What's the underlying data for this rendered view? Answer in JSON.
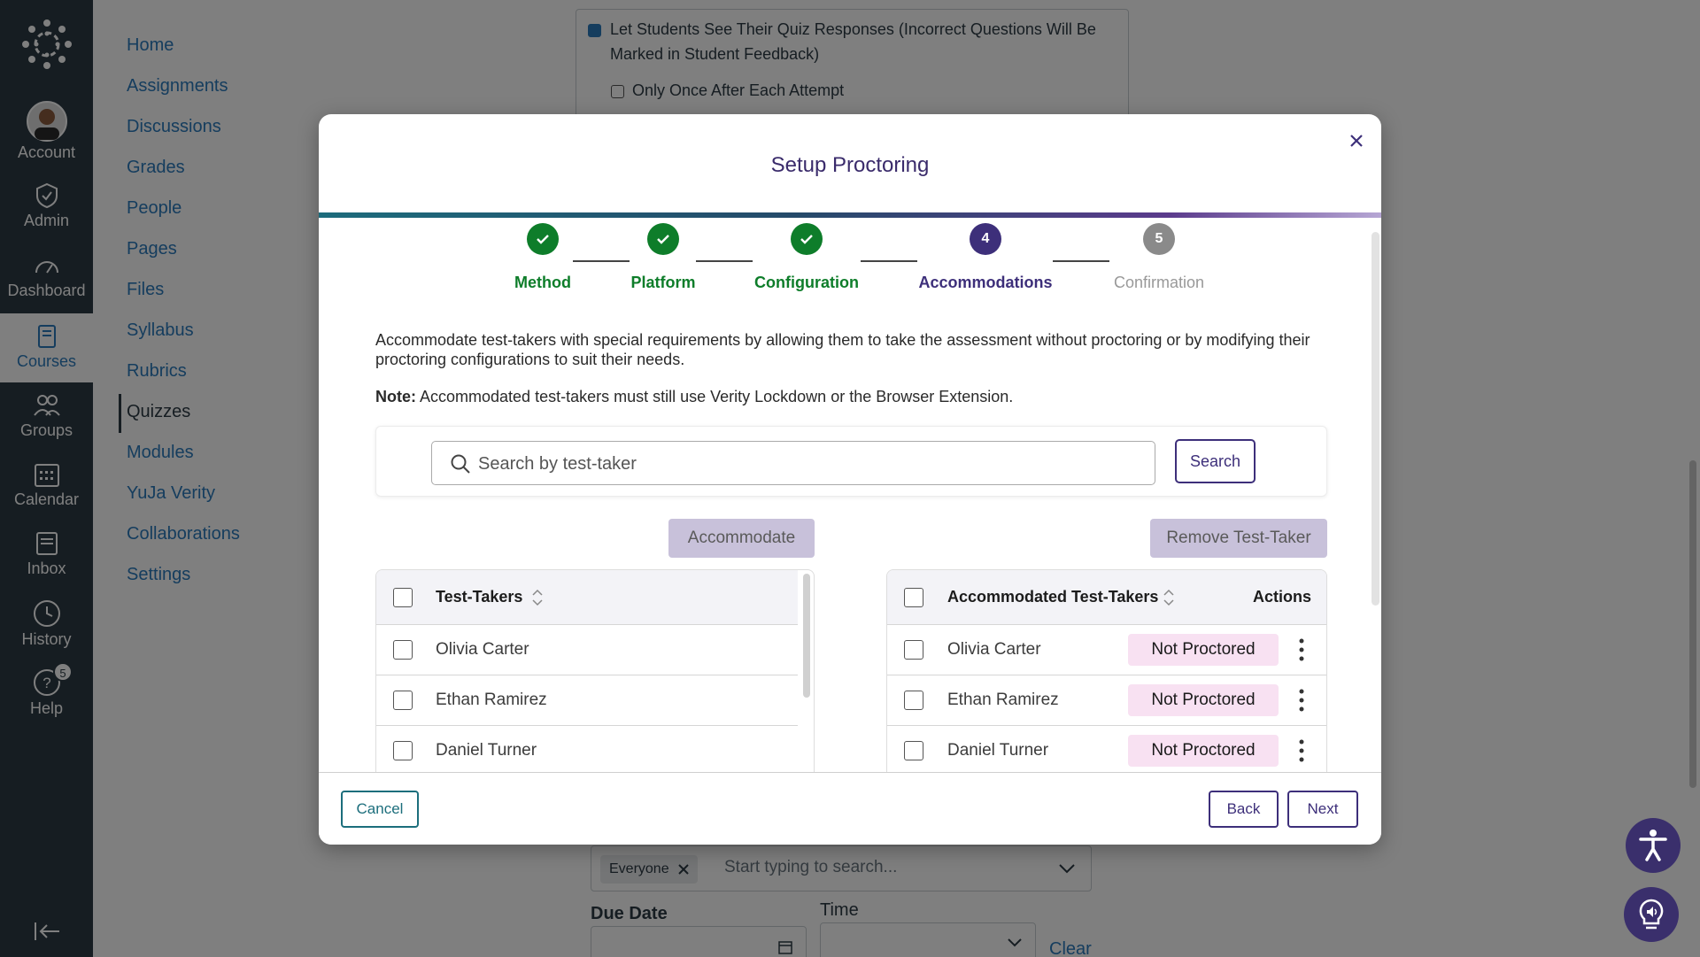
{
  "global_nav": {
    "account": "Account",
    "admin": "Admin",
    "dashboard": "Dashboard",
    "courses": "Courses",
    "groups": "Groups",
    "calendar": "Calendar",
    "inbox": "Inbox",
    "history": "History",
    "help": "Help",
    "help_badge": "5"
  },
  "course_nav": {
    "items": [
      "Home",
      "Assignments",
      "Discussions",
      "Grades",
      "People",
      "Pages",
      "Files",
      "Syllabus",
      "Rubrics",
      "Quizzes",
      "Modules",
      "YuJa Verity",
      "Collaborations",
      "Settings"
    ],
    "active": "Quizzes"
  },
  "background": {
    "option_1": "Let Students See Their Quiz Responses (Incorrect Questions Will Be",
    "option_1b": "Marked in Student Feedback)",
    "option_2": "Only Once After Each Attempt",
    "assign_chip": "Everyone",
    "assign_placeholder": "Start typing to search...",
    "due_date_label": "Due Date",
    "time_label": "Time",
    "clear_link": "Clear"
  },
  "modal": {
    "title": "Setup Proctoring",
    "steps": [
      {
        "label": "Method",
        "status": "done",
        "number": ""
      },
      {
        "label": "Platform",
        "status": "done",
        "number": ""
      },
      {
        "label": "Configuration",
        "status": "done",
        "number": ""
      },
      {
        "label": "Accommodations",
        "status": "current",
        "number": "4"
      },
      {
        "label": "Confirmation",
        "status": "todo",
        "number": "5"
      }
    ],
    "description": "Accommodate test-takers with special requirements by allowing them to take the assessment without proctoring or by modifying their proctoring configurations to suit their needs.",
    "note_label": "Note:",
    "note_text": " Accommodated test-takers must still use Verity Lockdown or the Browser Extension.",
    "search": {
      "placeholder": "Search by test-taker",
      "button": "Search"
    },
    "accommodate_button": "Accommodate",
    "remove_button": "Remove Test-Taker",
    "left_table": {
      "header": "Test-Takers",
      "rows": [
        "Olivia Carter",
        "Ethan Ramirez",
        "Daniel Turner"
      ]
    },
    "right_table": {
      "header": "Accommodated Test-Takers",
      "actions_header": "Actions",
      "rows": [
        {
          "name": "Olivia Carter",
          "status": "Not Proctored"
        },
        {
          "name": "Ethan Ramirez",
          "status": "Not Proctored"
        },
        {
          "name": "Daniel Turner",
          "status": "Not Proctored"
        }
      ]
    },
    "footer": {
      "cancel": "Cancel",
      "back": "Back",
      "next": "Next"
    }
  },
  "colors": {
    "nav_bg": "#2d3b45",
    "link": "#2b7abc",
    "brand_purple": "#3d2f7a",
    "done_green": "#0e7d2a",
    "badge_pink": "#f8e1f2"
  }
}
